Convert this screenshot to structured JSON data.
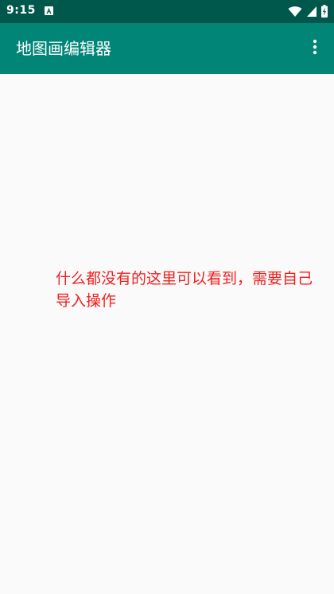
{
  "status_bar": {
    "time": "9:15",
    "notification_icon": "a-icon",
    "icons": [
      "wifi-icon",
      "cell-signal-icon",
      "battery-charging-icon"
    ]
  },
  "app_bar": {
    "title": "地图画编辑器",
    "menu_icon": "more-vert-icon",
    "background": "#008577"
  },
  "main": {
    "empty_message": "什么都没有的这里可以看到，需要自己导入操作",
    "message_color": "#f02020"
  },
  "colors": {
    "status_bar": "#00574b",
    "app_bar": "#008577",
    "background": "#fafafa"
  }
}
